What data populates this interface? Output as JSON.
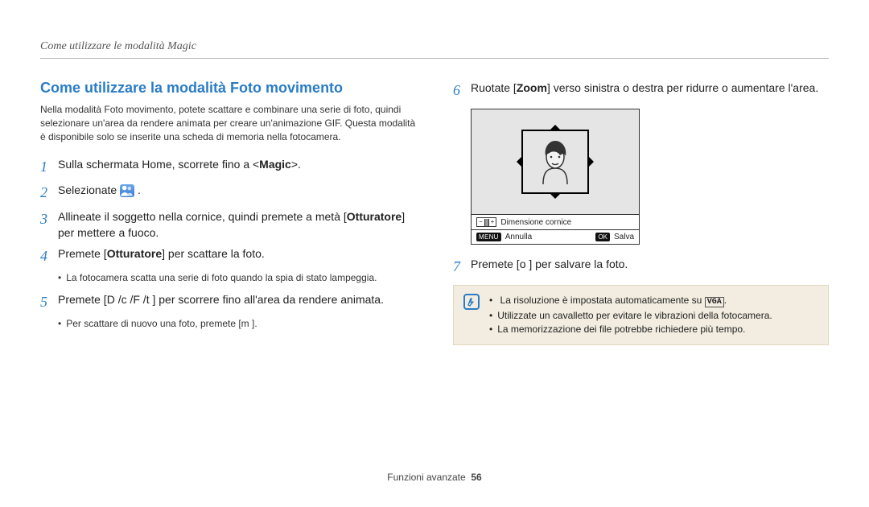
{
  "header": {
    "breadcrumb": "Come utilizzare le modalità Magic"
  },
  "section": {
    "title": "Come utilizzare la modalità Foto movimento",
    "intro": "Nella modalità Foto movimento, potete scattare e combinare una serie di foto, quindi selezionare un'area da rendere animata per creare un'animazione GIF. Questa modalità è disponibile solo se inserite una scheda di memoria nella fotocamera."
  },
  "steps": {
    "s1_pre": "Sulla schermata Home, scorrete fino a <",
    "s1_bold": "Magic",
    "s1_post": ">.",
    "s2": "Selezionate",
    "s2_end": ".",
    "s3a": "Allineate il soggetto nella cornice, quindi premete a metà [",
    "s3b": "Otturatore",
    "s3c": "] per mettere a fuoco.",
    "s4a": "Premete [",
    "s4b": "Otturatore",
    "s4c": "] per scattare la foto.",
    "s4_bul": "La fotocamera scatta una serie di foto quando la spia di stato lampeggia.",
    "s5": "Premete [D       /c   /F  /t     ] per scorrere fino all'area da rendere animata.",
    "s5_bul": "Per scattare di nuovo una foto, premete [m         ].",
    "s6a": "Ruotate [",
    "s6b": "Zoom",
    "s6c": "] verso sinistra o destra per ridurre o aumentare l'area.",
    "s7": "Premete [o       ] per salvare la foto."
  },
  "cam": {
    "zoom_label": "Dimensione cornice",
    "menu": "MENU",
    "cancel": "Annulla",
    "save": "Salva"
  },
  "note": {
    "n1a": "La risoluzione è impostata automaticamente su ",
    "n1b": "VGA",
    "n1c": ".",
    "n2": "Utilizzate un cavalletto per evitare le vibrazioni della fotocamera.",
    "n3": "La memorizzazione dei file potrebbe richiedere più tempo."
  },
  "footer": {
    "label": "Funzioni avanzate",
    "page": "56"
  }
}
